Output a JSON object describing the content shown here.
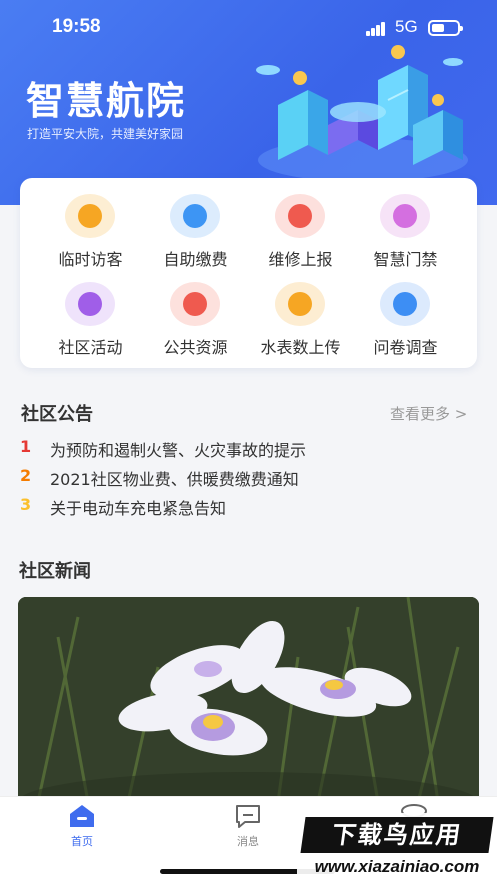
{
  "status_bar": {
    "time": "19:58",
    "network": "5G"
  },
  "header": {
    "title": "智慧航院",
    "subtitle": "打造平安大院，共建美好家园"
  },
  "services": [
    {
      "label": "临时访客",
      "icon": "visitor-icon",
      "bg": "#fdeed3",
      "fg": "#f6a623"
    },
    {
      "label": "自助缴费",
      "icon": "payment-icon",
      "bg": "#dcecfd",
      "fg": "#3d95f4"
    },
    {
      "label": "维修上报",
      "icon": "repair-icon",
      "bg": "#fde0dd",
      "fg": "#ef5a4f"
    },
    {
      "label": "智慧门禁",
      "icon": "door-access-icon",
      "bg": "#f6e3f7",
      "fg": "#d46fe0"
    },
    {
      "label": "社区活动",
      "icon": "activity-star-icon",
      "bg": "#efe3fb",
      "fg": "#a05ee8"
    },
    {
      "label": "公共资源",
      "icon": "public-resource-icon",
      "bg": "#fde1dd",
      "fg": "#ef5a4f"
    },
    {
      "label": "水表数上传",
      "icon": "water-meter-icon",
      "bg": "#fdedd2",
      "fg": "#f6a623"
    },
    {
      "label": "问卷调查",
      "icon": "survey-icon",
      "bg": "#dceafd",
      "fg": "#3d8ef4"
    }
  ],
  "announcements": {
    "title": "社区公告",
    "more": "查看更多 >",
    "items": [
      {
        "num": "1",
        "text": "为预防和遏制火警、火灾事故的提示",
        "color": "#e53935"
      },
      {
        "num": "2",
        "text": "2021社区物业费、供暖费缴费通知",
        "color": "#f57c00"
      },
      {
        "num": "3",
        "text": "关于电动车充电紧急告知",
        "color": "#fbc02d"
      }
    ]
  },
  "news": {
    "title": "社区新闻"
  },
  "tabs": [
    {
      "label": "首页",
      "icon": "home-icon",
      "active": true
    },
    {
      "label": "消息",
      "icon": "message-icon",
      "active": false
    },
    {
      "label": "",
      "icon": "profile-icon",
      "active": false
    }
  ],
  "watermark": {
    "main": "下载鸟应用",
    "url": "www.xiazainiao.com"
  },
  "colors": {
    "brand": "#3f6cee",
    "tab_active": "#3f6cee",
    "tab_inactive": "#888888"
  }
}
